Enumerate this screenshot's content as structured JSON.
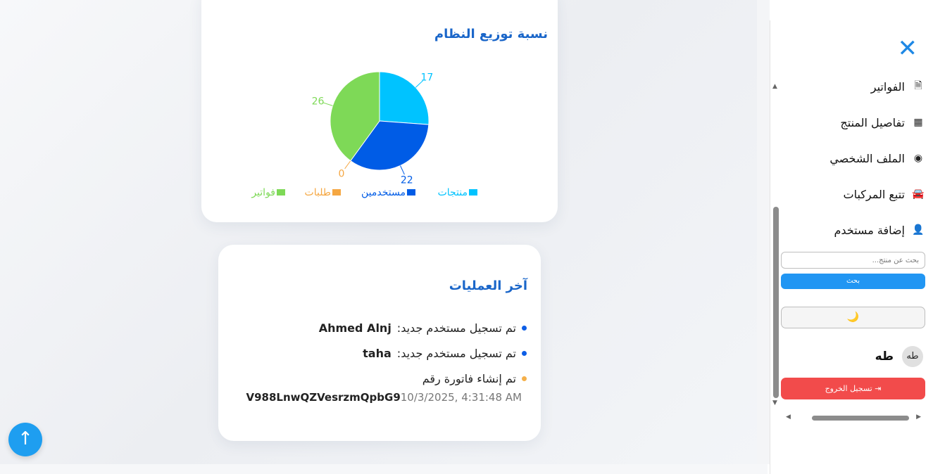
{
  "chart_card": {
    "title": "نسبة توزيع النظام"
  },
  "chart_data": {
    "type": "pie",
    "title": "نسبة توزيع النظام",
    "categories": [
      "منتجات",
      "مستخدمين",
      "طلبات",
      "فواتير"
    ],
    "values": [
      17,
      22,
      0,
      26
    ],
    "colors": [
      "#00c3ff",
      "#005ce6",
      "#f5a742",
      "#7ed957"
    ],
    "legend_position": "bottom"
  },
  "ops_card": {
    "title": "آخر العمليات",
    "items": [
      {
        "text": "تم تسجيل مستخدم جديد:",
        "bold": "Ahmed Alnj",
        "bullet_color": "#0d5ee6"
      },
      {
        "text": "تم تسجيل مستخدم جديد:",
        "bold": "taha",
        "bullet_color": "#0d5ee6"
      },
      {
        "text": "تم إنشاء فاتورة رقم",
        "bold": "",
        "bullet_color": "#f5b04a"
      }
    ],
    "invoice_code": "V988LnwQZVesrzmQpbG9",
    "invoice_time": "10/3/2025, 4:31:48 AM"
  },
  "scroll_top": {
    "label": "↑"
  },
  "sidebar": {
    "close_label": "✕",
    "items": [
      {
        "label": "الفواتير",
        "icon": "file-invoice-icon",
        "glyph": "🗎"
      },
      {
        "label": "تفاصيل المنتج",
        "icon": "box-icon",
        "glyph": "▦"
      },
      {
        "label": "الملف الشخصي",
        "icon": "user-circle-icon",
        "glyph": "◉"
      },
      {
        "label": "تتبع المركبات",
        "icon": "car-icon",
        "glyph": "🚘"
      },
      {
        "label": "إضافة مستخدم",
        "icon": "user-plus-icon",
        "glyph": "👤"
      }
    ],
    "search_placeholder": "بحث عن منتج...",
    "search_button": "بحث",
    "theme_toggle": "🌙",
    "user": {
      "avatar_text": "طه",
      "name": "طه"
    },
    "logout_label": "تسجيل الخروج",
    "logout_icon": "⇥"
  }
}
